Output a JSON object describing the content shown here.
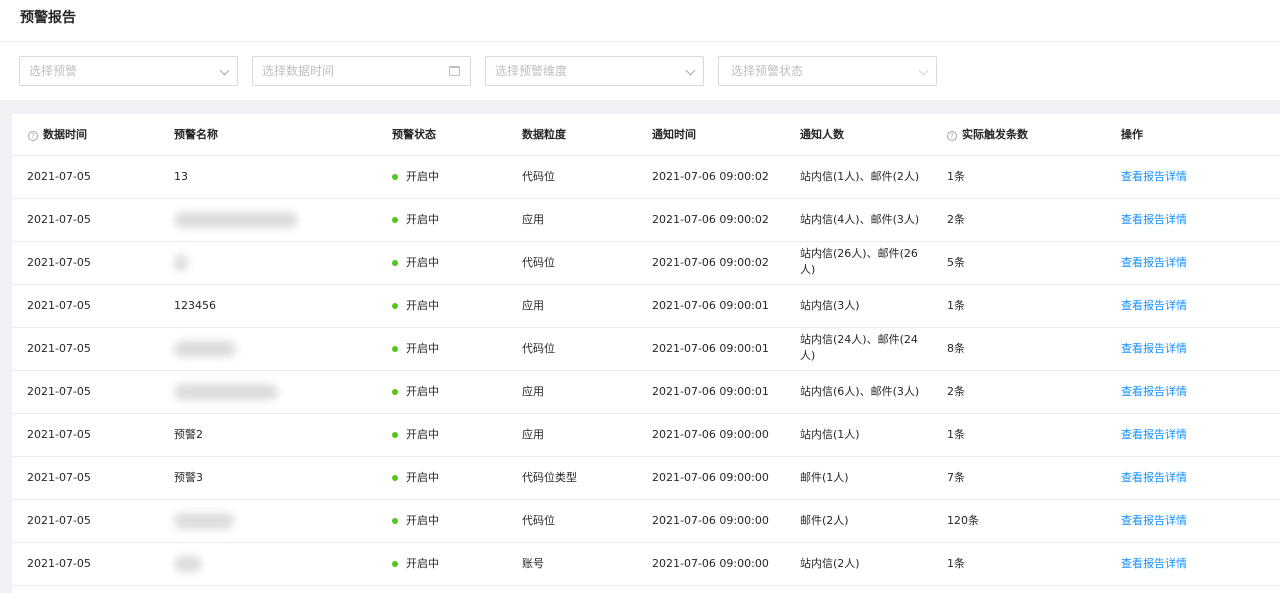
{
  "page": {
    "title": "预警报告"
  },
  "filters": {
    "alert": {
      "placeholder": "选择预警",
      "icon": "chevron-down-icon"
    },
    "time": {
      "placeholder": "选择数据时间",
      "icon": "calendar-icon"
    },
    "dimension": {
      "placeholder": "选择预警维度",
      "icon": "chevron-down-icon"
    },
    "status": {
      "placeholder": "选择预警状态",
      "icon": "chevron-down-icon"
    }
  },
  "table": {
    "columns": {
      "data_time": "数据时间",
      "name": "预警名称",
      "status": "预警状态",
      "granularity": "数据粒度",
      "notify_time": "通知时间",
      "notify_count": "通知人数",
      "triggered": "实际触发条数",
      "action": "操作"
    },
    "help_icon": "question-circle-icon",
    "status_dot_color": "#52c41a",
    "rows": [
      {
        "data_time": "2021-07-05",
        "name": "13",
        "status": "开启中",
        "granularity": "代码位",
        "notify_time": "2021-07-06 09:00:02",
        "notify_count": "站内信(1人)、邮件(2人)",
        "triggered": "1条",
        "action": "查看报告详情"
      },
      {
        "data_time": "2021-07-05",
        "name": "",
        "status": "开启中",
        "granularity": "应用",
        "notify_time": "2021-07-06 09:00:02",
        "notify_count": "站内信(4人)、邮件(3人)",
        "triggered": "2条",
        "action": "查看报告详情"
      },
      {
        "data_time": "2021-07-05",
        "name": "",
        "status": "开启中",
        "granularity": "代码位",
        "notify_time": "2021-07-06 09:00:02",
        "notify_count": "站内信(26人)、邮件(26人)",
        "triggered": "5条",
        "action": "查看报告详情"
      },
      {
        "data_time": "2021-07-05",
        "name": "123456",
        "status": "开启中",
        "granularity": "应用",
        "notify_time": "2021-07-06 09:00:01",
        "notify_count": "站内信(3人)",
        "triggered": "1条",
        "action": "查看报告详情"
      },
      {
        "data_time": "2021-07-05",
        "name": "",
        "status": "开启中",
        "granularity": "代码位",
        "notify_time": "2021-07-06 09:00:01",
        "notify_count": "站内信(24人)、邮件(24人)",
        "triggered": "8条",
        "action": "查看报告详情"
      },
      {
        "data_time": "2021-07-05",
        "name": "",
        "status": "开启中",
        "granularity": "应用",
        "notify_time": "2021-07-06 09:00:01",
        "notify_count": "站内信(6人)、邮件(3人)",
        "triggered": "2条",
        "action": "查看报告详情"
      },
      {
        "data_time": "2021-07-05",
        "name": "预警2",
        "status": "开启中",
        "granularity": "应用",
        "notify_time": "2021-07-06 09:00:00",
        "notify_count": "站内信(1人)",
        "triggered": "1条",
        "action": "查看报告详情"
      },
      {
        "data_time": "2021-07-05",
        "name": "预警3",
        "status": "开启中",
        "granularity": "代码位类型",
        "notify_time": "2021-07-06 09:00:00",
        "notify_count": "邮件(1人)",
        "triggered": "7条",
        "action": "查看报告详情"
      },
      {
        "data_time": "2021-07-05",
        "name": "",
        "status": "开启中",
        "granularity": "代码位",
        "notify_time": "2021-07-06 09:00:00",
        "notify_count": "邮件(2人)",
        "triggered": "120条",
        "action": "查看报告详情"
      },
      {
        "data_time": "2021-07-05",
        "name": "",
        "status": "开启中",
        "granularity": "账号",
        "notify_time": "2021-07-06 09:00:00",
        "notify_count": "站内信(2人)",
        "triggered": "1条",
        "action": "查看报告详情"
      }
    ]
  }
}
